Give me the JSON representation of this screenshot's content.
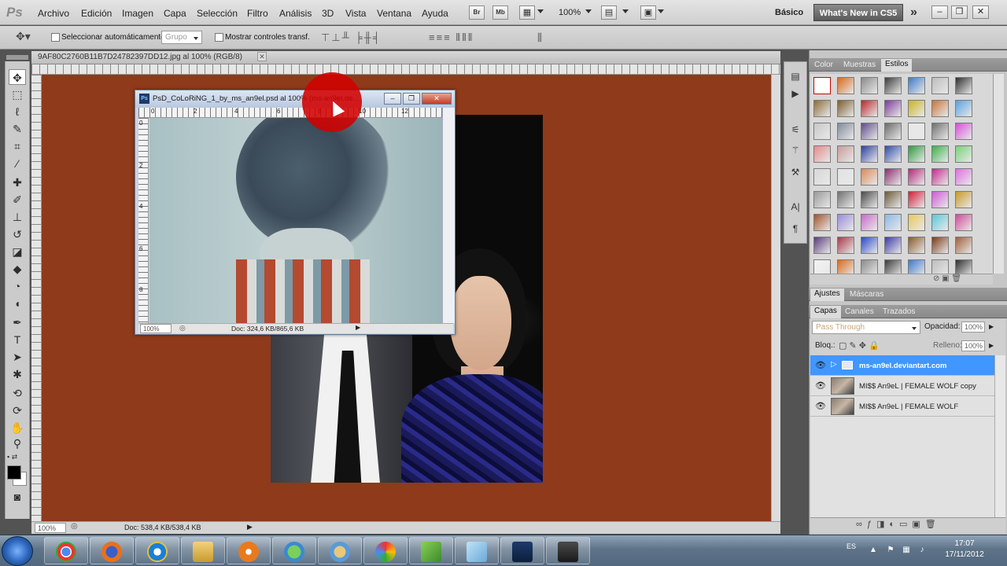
{
  "app": {
    "logo": "Ps"
  },
  "menu": [
    "Archivo",
    "Edición",
    "Imagen",
    "Capa",
    "Selección",
    "Filtro",
    "Análisis",
    "3D",
    "Vista",
    "Ventana",
    "Ayuda"
  ],
  "menubar_buttons": {
    "bridge": "Br",
    "minibridge": "Mb",
    "zoom_value": "100%"
  },
  "workspace": {
    "label": "Básico",
    "whats_new": "What's New in CS5",
    "more": "»"
  },
  "window_controls": {
    "minimize": "–",
    "restore": "❐",
    "close": "✕"
  },
  "options": {
    "auto_select_label": "Seleccionar automáticamente:",
    "auto_select_value": "Grupo",
    "transform_label": "Mostrar controles transf."
  },
  "document": {
    "tab_title": "9AF80C2760B11B7D24782397DD12.jpg al 100% (RGB/8)",
    "tab_close": "✕",
    "zoom": "100%",
    "doc_info": "Doc: 538,4 KB/538,4 KB"
  },
  "subwindow": {
    "icon": "Ps",
    "title": "PsD_CoLoRiNG_1_by_ms_an9el.psd al 100% (ms-an9el.de...",
    "zoom": "100%",
    "doc_info": "Doc: 324,6 KB/865,6 KB",
    "ruler_h": [
      "0",
      "2",
      "4",
      "6",
      "8",
      "10",
      "12"
    ],
    "ruler_v": [
      "0",
      "2",
      "4",
      "6",
      "8"
    ]
  },
  "panels": {
    "top_tabs": [
      "Color",
      "Muestras",
      "Estilos"
    ],
    "active_top_tab": "Estilos",
    "mid_tabs": [
      "Ajustes",
      "Máscaras"
    ],
    "layer_tabs": [
      "Capas",
      "Canales",
      "Trazados"
    ],
    "blend_mode": "Pass Through",
    "opacity_label": "Opacidad:",
    "opacity_value": "100%",
    "lock_label": "Bloq.:",
    "fill_label": "Relleno:",
    "fill_value": "100%"
  },
  "layers": [
    {
      "name": "ms-an9el.deviantart.com",
      "type": "group",
      "selected": true
    },
    {
      "name": "MI$$ An9eL | FEMALE WOLF copy",
      "type": "image",
      "selected": false
    },
    {
      "name": "MI$$ An9eL | FEMALE WOLF",
      "type": "image",
      "selected": false
    }
  ],
  "taskbar": {
    "apps": [
      "chrome-icon",
      "firefox-icon",
      "ie-icon",
      "explorer-icon",
      "media-player-icon",
      "messenger-icon",
      "paint-icon",
      "picasa-icon",
      "excel-icon",
      "notepad-icon",
      "photoshop-icon",
      "camtasia-icon"
    ],
    "lang": "ES",
    "time": "17:07",
    "date": "17/11/2012"
  },
  "colors": {
    "canvas_bg": "#8f3a1a",
    "selection": "#3f97ff",
    "red_marker": "#d20000"
  }
}
